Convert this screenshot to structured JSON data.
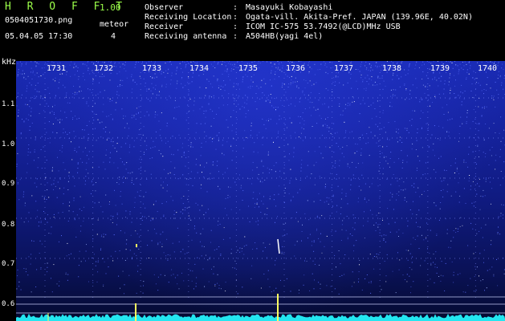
{
  "header": {
    "app_title": "H R O F F T",
    "app_version": "1.00",
    "file_name": "0504051730.png",
    "meteor_label": "meteor",
    "date_time": "05.04.05 17:30",
    "meteor_count": "4"
  },
  "info": {
    "observer_label": "Observer",
    "observer_value": "Masayuki Kobayashi",
    "location_label": "Receiving Location",
    "location_value": "Ogata-vill. Akita-Pref. JAPAN (139.96E, 40.02N)",
    "receiver_label": "Receiver",
    "receiver_value": "ICOM IC-575 53.7492(@LCD)MHz USB",
    "antenna_label": "Receiving antenna",
    "antenna_value": "A504HB(yagi 4el)",
    "separator": ":"
  },
  "axis": {
    "y_unit": "kHz",
    "y_ticks": [
      "1.1",
      "1.0",
      "0.9",
      "0.8",
      "0.7",
      "0.6"
    ],
    "x_ticks": [
      "1731",
      "1732",
      "1733",
      "1734",
      "1735",
      "1736",
      "1737",
      "1738",
      "1739",
      "1740"
    ]
  },
  "colors": {
    "title_green": "#9cff4a",
    "trace_cyan": "#23e6f0",
    "signal_yellow": "#ffff60"
  }
}
